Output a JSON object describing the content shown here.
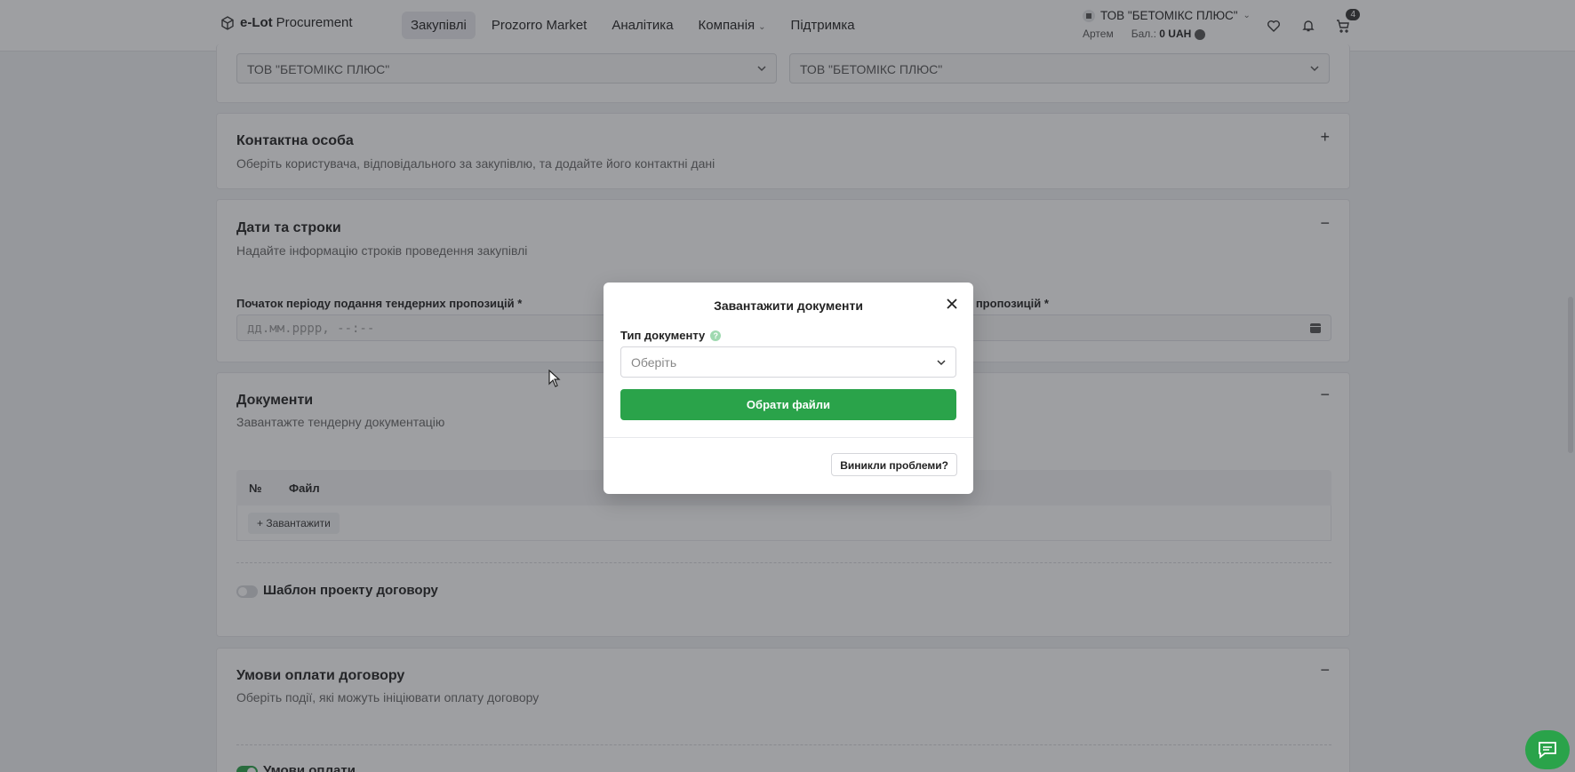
{
  "header": {
    "logo_bold": "e-Lot",
    "logo_rest": "Procurement",
    "nav": [
      "Закупівлі",
      "Prozorro Market",
      "Аналітика",
      "Компанія",
      "Підтримка"
    ],
    "org_name": "ТОВ \"БЕТОМІКС ПЛЮС\"",
    "user": "Артем",
    "balance_label": "Бал.:",
    "balance_value": "0 UAH",
    "cart_count": "4"
  },
  "form": {
    "customer_select_1": "ТОВ \"БЕТОМІКС ПЛЮС\"",
    "customer_select_2": "ТОВ \"БЕТОМІКС ПЛЮС\"",
    "contact": {
      "title": "Контактна особа",
      "subtitle": "Оберіть користувача, відповідального за закупівлю, та додайте його контактні дані",
      "sign": "+"
    },
    "dates": {
      "title": "Дати та строки",
      "subtitle": "Надайте інформацію строків проведення закупівлі",
      "sign": "−",
      "start_label": "Початок періоду подання тендерних пропозицій *",
      "start_placeholder": "дд.мм.рррр, --:--",
      "end_label_visible": "их пропозицій *"
    },
    "documents": {
      "title": "Документи",
      "subtitle": "Завантажте тендерну документацію",
      "sign": "−",
      "col_no": "№",
      "col_file": "Файл",
      "upload": "+ Завантажити",
      "template_label": "Шаблон проекту договору"
    },
    "payment": {
      "title": "Умови оплати договору",
      "subtitle": "Оберіть події, які можуть ініціювати оплату договору",
      "sign": "−",
      "toggle_label": "Умови оплати"
    }
  },
  "modal": {
    "title": "Завантажити документи",
    "type_label": "Тип документу",
    "type_placeholder": "Оберіть",
    "select_files": "Обрати файли",
    "problems": "Виникли проблеми?"
  },
  "colors": {
    "accent_green": "#2aa34a",
    "overlay": "rgba(40,42,48,0.45)"
  }
}
